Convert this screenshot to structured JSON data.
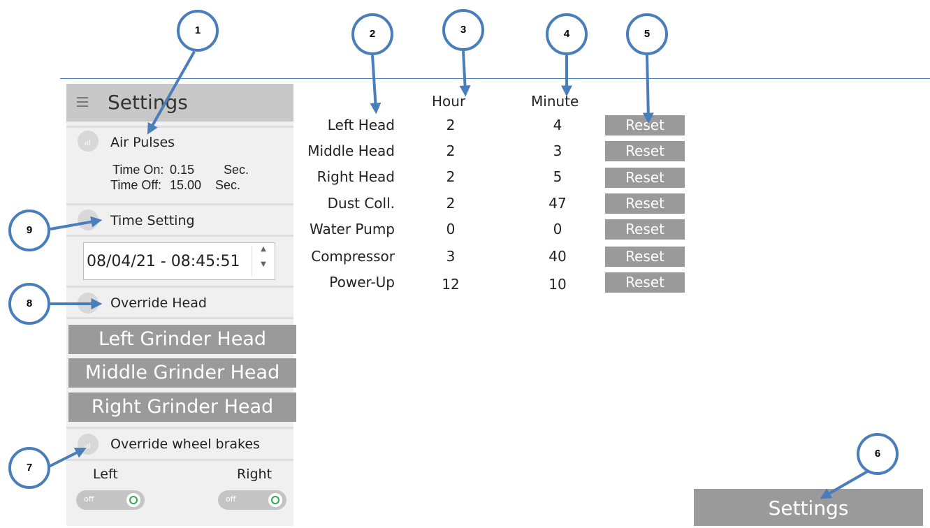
{
  "sidebar": {
    "title": "Settings",
    "air_pulses": {
      "label": "Air Pulses",
      "time_on_label": "Time On:",
      "time_on_value": "0.15",
      "time_on_unit": "Sec.",
      "time_off_label": "Time Off:",
      "time_off_value": "15.00",
      "time_off_unit": "Sec."
    },
    "time_setting": {
      "label": "Time Setting",
      "value": "08/04/21 - 08:45:51"
    },
    "override_head": {
      "label": "Override Head",
      "buttons": [
        "Left Grinder Head",
        "Middle Grinder Head",
        "Right Grinder Head"
      ]
    },
    "override_wheel_brakes": {
      "label": "Override wheel brakes",
      "left_label": "Left",
      "right_label": "Right",
      "left_state": "off",
      "right_state": "off"
    }
  },
  "table": {
    "hour_header": "Hour",
    "minute_header": "Minute",
    "reset_label": "Reset",
    "rows": [
      {
        "label": "Left Head",
        "hour": "2",
        "minute": "4"
      },
      {
        "label": "Middle Head",
        "hour": "2",
        "minute": "3"
      },
      {
        "label": "Right Head",
        "hour": "2",
        "minute": "5"
      },
      {
        "label": "Dust Coll.",
        "hour": "2",
        "minute": "47"
      },
      {
        "label": "Water Pump",
        "hour": "0",
        "minute": "0"
      },
      {
        "label": "Compressor",
        "hour": "3",
        "minute": "40"
      },
      {
        "label": "Power-Up",
        "hour": "12",
        "minute": "10"
      }
    ]
  },
  "settings_button": "Settings",
  "callouts": [
    "1",
    "2",
    "3",
    "4",
    "5",
    "6",
    "7",
    "8",
    "9"
  ],
  "colors": {
    "callout_blue": "#4a7ebb",
    "button_gray": "#9a9a9a",
    "toggle_green": "#2fa84f"
  }
}
